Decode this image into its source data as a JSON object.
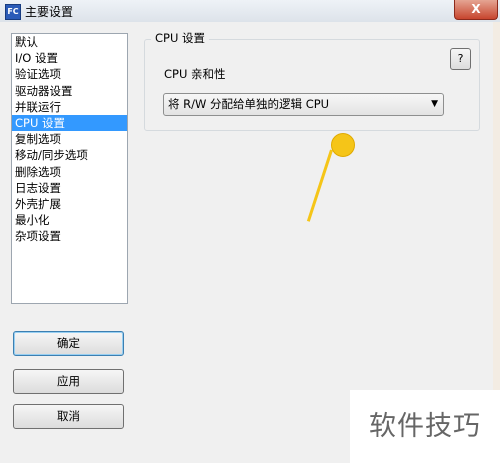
{
  "window": {
    "title": "主要设置",
    "app_icon_text": "FC",
    "close_label": "X"
  },
  "sidebar": {
    "items": [
      {
        "label": "默认"
      },
      {
        "label": "I/O 设置"
      },
      {
        "label": "验证选项"
      },
      {
        "label": "驱动器设置"
      },
      {
        "label": "并联运行"
      },
      {
        "label": "CPU 设置",
        "selected": true
      },
      {
        "label": "复制选项"
      },
      {
        "label": "移动/同步选项"
      },
      {
        "label": "删除选项"
      },
      {
        "label": "日志设置"
      },
      {
        "label": "外壳扩展"
      },
      {
        "label": "最小化"
      },
      {
        "label": "杂项设置"
      }
    ]
  },
  "buttons": {
    "ok": "确定",
    "apply": "应用",
    "cancel": "取消",
    "help": "?"
  },
  "cpu_group": {
    "legend": "CPU 设置",
    "affinity_label": "CPU 亲和性",
    "affinity_value": "将 R/W 分配给单独的逻辑 CPU",
    "dropdown_arrow": "▼"
  },
  "watermark": "软件技巧",
  "colors": {
    "selection": "#3399ff",
    "annotation": "#f5c518"
  }
}
